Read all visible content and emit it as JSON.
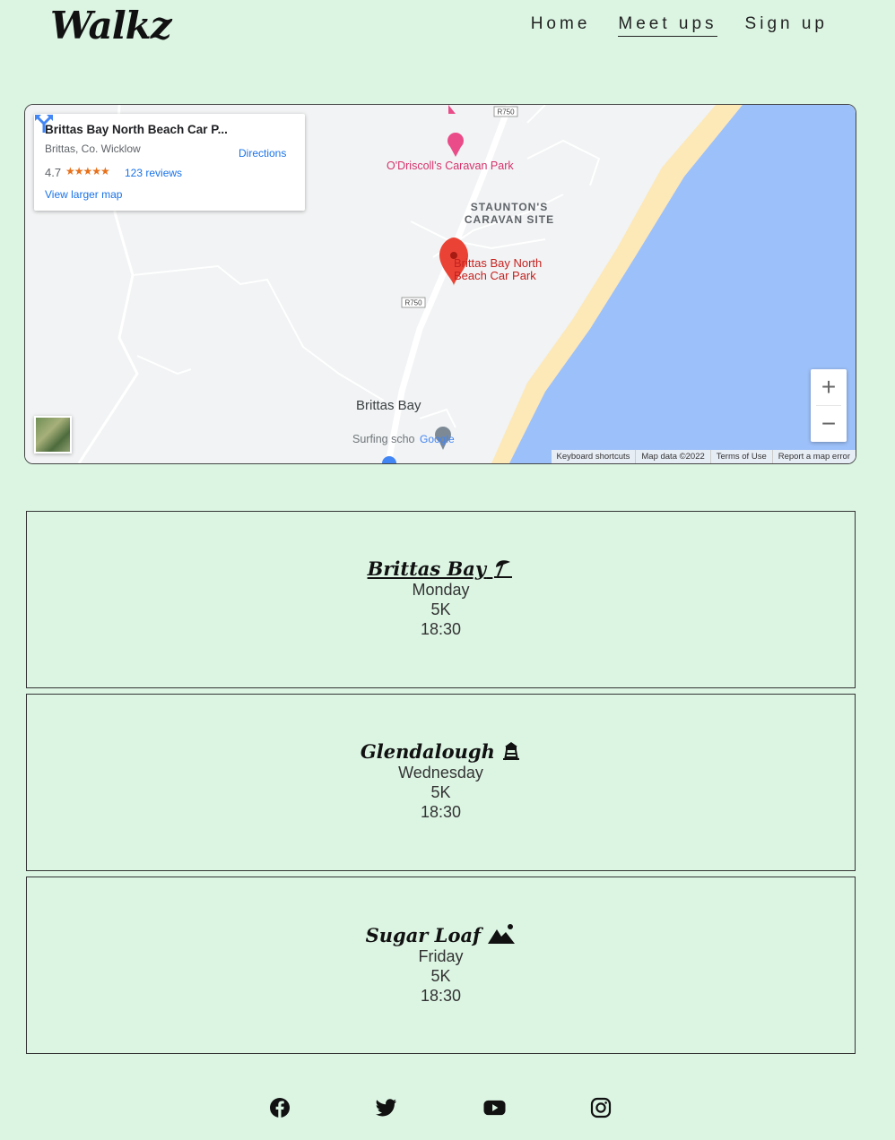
{
  "brand": "Walkz",
  "nav": [
    {
      "label": "Home",
      "active": false
    },
    {
      "label": "Meet ups",
      "active": true
    },
    {
      "label": "Sign up",
      "active": false
    }
  ],
  "map": {
    "info": {
      "title": "Brittas Bay North Beach Car P...",
      "address": "Brittas, Co. Wicklow",
      "rating": "4.7",
      "stars": "★★★★★",
      "reviews": "123 reviews",
      "larger_link": "View larger map",
      "directions": "Directions"
    },
    "labels": {
      "caravan_park": "O'Driscoll's Caravan Park",
      "site_line1": "STAUNTON'S",
      "site_line2": "CARAVAN SITE",
      "marker_line1": "Brittas Bay North",
      "marker_line2": "Beach Car Park",
      "road1": "R750",
      "road2": "R750",
      "town": "Brittas Bay",
      "school": "Surfing scho",
      "google": "Google"
    },
    "zoom_in": "+",
    "zoom_out": "−",
    "attribution": [
      "Keyboard shortcuts",
      "Map data ©2022",
      "Terms of Use",
      "Report a map error"
    ],
    "colors": {
      "land": "#f1f3f4",
      "sea": "#9cc0f9",
      "sand": "#fde8b8",
      "road": "#ffffff",
      "marker": "#ea4335"
    }
  },
  "meetups": [
    {
      "name": "Brittas Bay",
      "icon": "umbrella-beach-icon",
      "day": "Monday",
      "distance": "5K",
      "time": "18:30"
    },
    {
      "name": "Glendalough",
      "icon": "tower-icon",
      "day": "Wednesday",
      "distance": "5K",
      "time": "18:30"
    },
    {
      "name": "Sugar Loaf",
      "icon": "mountain-icon",
      "day": "Friday",
      "distance": "5K",
      "time": "18:30"
    }
  ],
  "social": [
    "facebook-icon",
    "twitter-icon",
    "youtube-icon",
    "instagram-icon"
  ]
}
